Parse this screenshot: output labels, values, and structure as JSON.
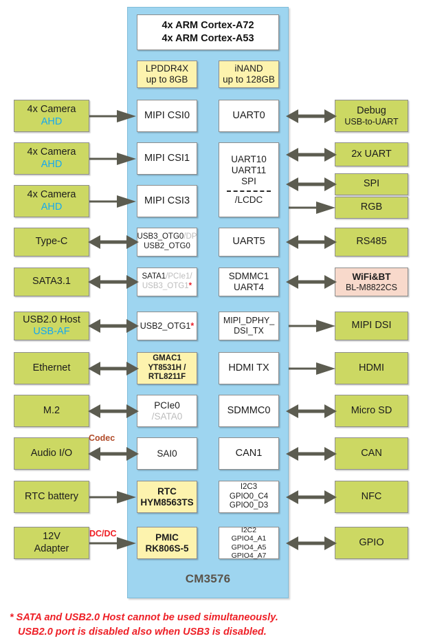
{
  "soc": {
    "name": "CM3576",
    "cpu": {
      "line1": "4x ARM Cortex-A72",
      "line2": "4x ARM Cortex-A53"
    },
    "memory": [
      {
        "name": "lpddr4x",
        "line1": "LPDDR4X",
        "line2": "up to 8GB"
      },
      {
        "name": "inand",
        "line1": "iNAND",
        "line2": "up to 128GB"
      }
    ],
    "left_column": [
      {
        "name": "mipi-csi0",
        "lines": [
          "MIPI CSI0"
        ]
      },
      {
        "name": "mipi-csi1",
        "lines": [
          "MIPI CSI1"
        ]
      },
      {
        "name": "mipi-csi3",
        "lines": [
          "MIPI CSI3"
        ]
      },
      {
        "name": "usb3-otg0",
        "lines": [
          "USB3_OTG0",
          "/DP",
          "USB2_OTG0"
        ]
      },
      {
        "name": "sata1",
        "lines": [
          "SATA1",
          "/PCIe1/",
          "USB3_OTG1",
          "*"
        ]
      },
      {
        "name": "usb2-otg1",
        "lines": [
          "USB2_OTG1",
          "*"
        ]
      },
      {
        "name": "gmac1",
        "lines": [
          "GMAC1",
          "YT8531H /",
          "RTL8211F"
        ]
      },
      {
        "name": "pcie0",
        "lines": [
          "PCIe0",
          "/SATA0"
        ]
      },
      {
        "name": "sai0",
        "lines": [
          "SAI0"
        ]
      },
      {
        "name": "rtc",
        "lines": [
          "RTC",
          "HYM8563TS"
        ]
      },
      {
        "name": "pmic",
        "lines": [
          "PMIC",
          "RK806S-5"
        ]
      }
    ],
    "right_column": [
      {
        "name": "uart0",
        "lines": [
          "UART0"
        ]
      },
      {
        "name": "uart10-spi",
        "lines": [
          "UART10",
          "UART11",
          "SPI",
          "/LCDC"
        ]
      },
      {
        "name": "uart5",
        "lines": [
          "UART5"
        ]
      },
      {
        "name": "sdmmc1",
        "lines": [
          "SDMMC1",
          "UART4"
        ]
      },
      {
        "name": "mipi-dphy",
        "lines": [
          "MIPI_DPHY_",
          "DSI_TX"
        ]
      },
      {
        "name": "hdmi-tx",
        "lines": [
          "HDMI TX"
        ]
      },
      {
        "name": "sdmmc0",
        "lines": [
          "SDMMC0"
        ]
      },
      {
        "name": "can1",
        "lines": [
          "CAN1"
        ]
      },
      {
        "name": "i2c3",
        "lines": [
          "I2C3",
          "GPIO0_C4",
          "GPIO0_D3"
        ]
      },
      {
        "name": "i2c2",
        "lines": [
          "I2C2",
          "GPIO4_A1",
          "GPIO4_A5",
          "GPIO4_A7"
        ]
      }
    ]
  },
  "peripherals_left": [
    {
      "name": "camera-1",
      "line1": "4x Camera",
      "line2": "AHD",
      "arrow": "right"
    },
    {
      "name": "camera-2",
      "line1": "4x Camera",
      "line2": "AHD",
      "arrow": "right"
    },
    {
      "name": "camera-3",
      "line1": "4x Camera",
      "line2": "AHD",
      "arrow": "right"
    },
    {
      "name": "type-c",
      "line1": "Type-C",
      "line2": "",
      "arrow": "both"
    },
    {
      "name": "sata31",
      "line1": "SATA3.1",
      "line2": "",
      "arrow": "both"
    },
    {
      "name": "usb20-host",
      "line1": "USB2.0 Host",
      "line2": "USB-AF",
      "arrow": "both"
    },
    {
      "name": "ethernet",
      "line1": "Ethernet",
      "line2": "",
      "arrow": "both"
    },
    {
      "name": "m2",
      "line1": "M.2",
      "line2": "",
      "arrow": "both"
    },
    {
      "name": "audio-io",
      "line1": "Audio I/O",
      "line2": "",
      "arrow": "both",
      "connector": "Codec"
    },
    {
      "name": "rtc-battery",
      "line1": "RTC battery",
      "line2": "",
      "arrow": "right"
    },
    {
      "name": "adapter-12v",
      "line1": "12V",
      "line2": "Adapter",
      "arrow": "right",
      "connector": "DC/DC"
    }
  ],
  "peripherals_right": [
    {
      "name": "debug-uart",
      "line1": "Debug",
      "line2": "USB-to-UART",
      "arrow": "both"
    },
    {
      "name": "uart-2x",
      "line1": "2x UART",
      "line2": "",
      "arrow": "both"
    },
    {
      "name": "spi",
      "line1": "SPI",
      "line2": "",
      "arrow": "both"
    },
    {
      "name": "rgb",
      "line1": "RGB",
      "line2": "",
      "arrow": "right"
    },
    {
      "name": "rs485",
      "line1": "RS485",
      "line2": "",
      "arrow": "both"
    },
    {
      "name": "wifi-bt",
      "line1": "WiFi&BT",
      "line2": "BL-M8822CS",
      "arrow": "both"
    },
    {
      "name": "mipi-dsi",
      "line1": "MIPI DSI",
      "line2": "",
      "arrow": "right"
    },
    {
      "name": "hdmi",
      "line1": "HDMI",
      "line2": "",
      "arrow": "right"
    },
    {
      "name": "micro-sd",
      "line1": "Micro SD",
      "line2": "",
      "arrow": "both"
    },
    {
      "name": "can",
      "line1": "CAN",
      "line2": "",
      "arrow": "both"
    },
    {
      "name": "nfc",
      "line1": "NFC",
      "line2": "",
      "arrow": "both"
    },
    {
      "name": "gpio",
      "line1": "GPIO",
      "line2": "",
      "arrow": "both"
    }
  ],
  "footnote": {
    "line1": "* SATA and USB2.0 Host cannot be used simultaneously.",
    "line2": "USB2.0 port is disabled also when USB3 is disabled."
  },
  "colors": {
    "soc_panel": "#9ed5f0",
    "peripheral": "#ccd863",
    "internal": "#ffffff",
    "memory": "#fdf3ae",
    "module": "#f8d9cb",
    "accent_blue": "#14a8f0",
    "accent_red": "#ee2027",
    "arrow": "#5c5c50"
  }
}
